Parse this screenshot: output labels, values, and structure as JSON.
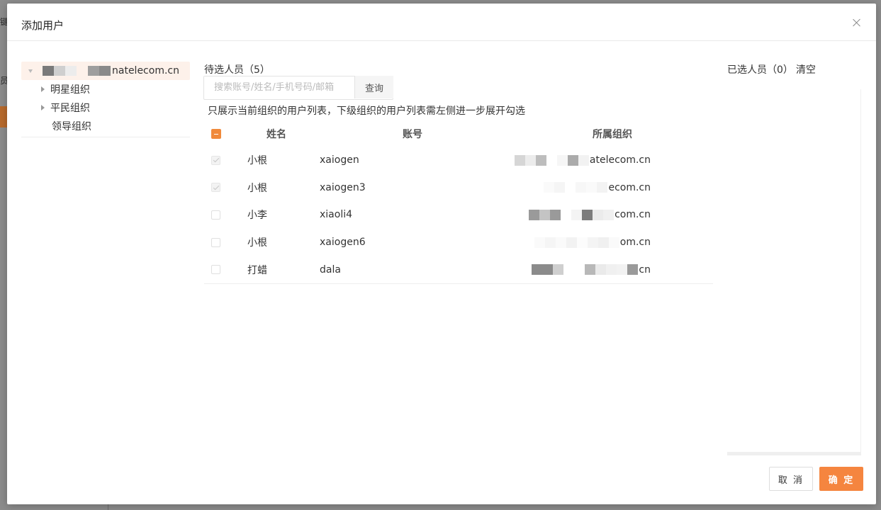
{
  "background": {
    "frag_a": "键",
    "frag_b": "员名"
  },
  "modal": {
    "title": "添加用户"
  },
  "tree": {
    "root_suffix": "natelecom.cn",
    "children": [
      {
        "label": "明星组织",
        "expandable": true
      },
      {
        "label": "平民组织",
        "expandable": true
      },
      {
        "label": "领导组织",
        "expandable": false
      }
    ]
  },
  "pending": {
    "title": "待选人员（5）",
    "search_placeholder": "搜索账号/姓名/手机号码/邮箱",
    "search_button": "查询",
    "hint": "只展示当前组织的用户列表，下级组织的用户列表需左侧进一步展开勾选",
    "columns": {
      "name": "姓名",
      "account": "账号",
      "org": "所属组织"
    },
    "rows": [
      {
        "name": "小根",
        "account": "xaiogen",
        "org_suffix": "atelecom.cn",
        "state": "disabled-checked"
      },
      {
        "name": "小根",
        "account": "xaiogen3",
        "org_suffix": "ecom.cn",
        "state": "disabled-checked"
      },
      {
        "name": "小李",
        "account": "xiaoli4",
        "org_suffix": "com.cn",
        "state": "unchecked"
      },
      {
        "name": "小根",
        "account": "xaiogen6",
        "org_suffix": "om.cn",
        "state": "unchecked"
      },
      {
        "name": "打蜡",
        "account": "dala",
        "org_suffix": "cn",
        "state": "unchecked"
      }
    ]
  },
  "selected": {
    "title": "已选人员（0）",
    "clear": "清空"
  },
  "footer": {
    "cancel": "取 消",
    "ok": "确 定"
  },
  "colors": {
    "accent": "#f5853f",
    "tree_selected_bg": "#fdf1ea"
  }
}
